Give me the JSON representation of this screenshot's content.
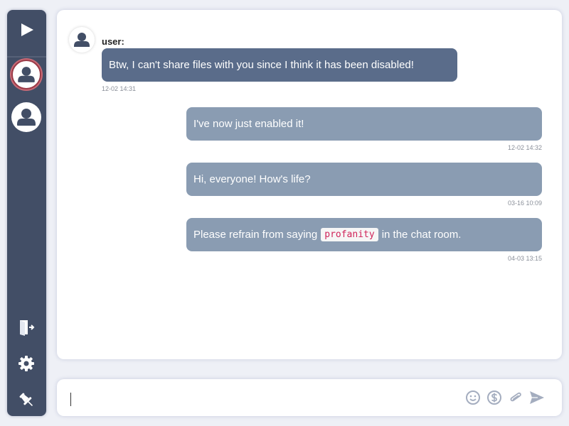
{
  "sidebar": {
    "play_icon": "play-icon",
    "users": [
      {
        "icon": "user-icon",
        "active": true
      },
      {
        "icon": "user-icon",
        "active": false
      }
    ],
    "bottom_icons": [
      "exit-door-icon",
      "gear-icon",
      "pin-icon"
    ]
  },
  "chat": {
    "messages": [
      {
        "sender": "user:",
        "text": "Btw, I can't share files with you since I think it has been disabled!",
        "time": "12-02 14:31",
        "side": "incoming"
      },
      {
        "text": "I've now just enabled it!",
        "time": "12-02 14:32",
        "side": "outgoing"
      },
      {
        "text": "Hi, everyone! How's life?",
        "time": "03-16 10:09",
        "side": "outgoing"
      },
      {
        "text_before": "Please refrain from saying",
        "code": "profanity",
        "text_after": "in the chat room.",
        "time": "04-03 13:15",
        "side": "outgoing"
      }
    ]
  },
  "input": {
    "value": "",
    "placeholder": "",
    "icons": [
      "emoji-icon",
      "dollar-icon",
      "paperclip-icon",
      "send-icon"
    ]
  },
  "colors": {
    "sidebar_bg": "#424e66",
    "incoming_bubble": "#5a6c8a",
    "outgoing_bubble": "#8a9cb2",
    "code_text": "#d0245a",
    "icon_gray": "#a4adbf"
  }
}
